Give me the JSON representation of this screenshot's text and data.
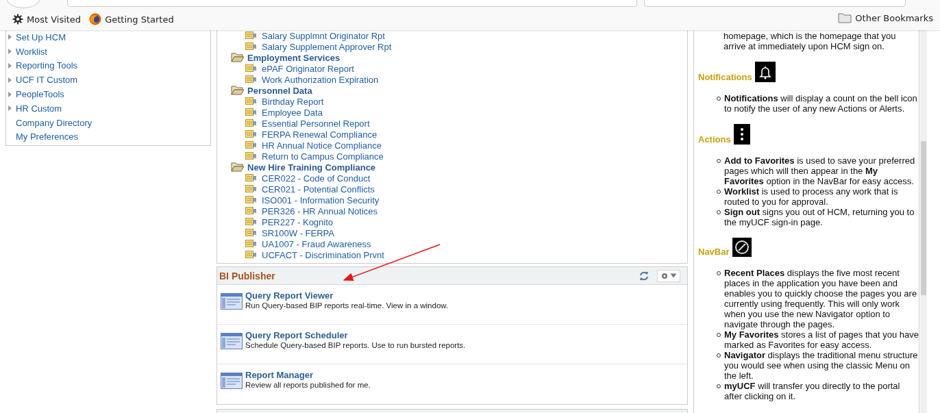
{
  "browser": {
    "bookmarks": [
      {
        "kind": "gear",
        "label": "Most Visited"
      },
      {
        "kind": "firefox",
        "label": "Getting Started"
      }
    ],
    "other_bookmarks": "Other Bookmarks"
  },
  "sidebar": {
    "items": [
      {
        "label": "Set Up HCM",
        "expandable": true
      },
      {
        "label": "Worklist",
        "expandable": true
      },
      {
        "label": "Reporting Tools",
        "expandable": true
      },
      {
        "label": "UCF IT Custom",
        "expandable": true
      },
      {
        "label": "PeopleTools",
        "expandable": true
      },
      {
        "label": "HR Custom",
        "expandable": true
      },
      {
        "label": "Company Directory",
        "expandable": false
      },
      {
        "label": "My Preferences",
        "expandable": false
      }
    ]
  },
  "report_tree": [
    {
      "kind": "report",
      "label": "Salary Supplmnt Originator Rpt"
    },
    {
      "kind": "report",
      "label": "Salary Supplement Approver Rpt"
    },
    {
      "kind": "folder",
      "label": "Employment Services",
      "children": [
        {
          "kind": "report",
          "label": "ePAF Originator Report"
        },
        {
          "kind": "report",
          "label": "Work Authorization Expiration"
        }
      ]
    },
    {
      "kind": "folder",
      "label": "Personnel Data",
      "children": [
        {
          "kind": "report",
          "label": "Birthday Report"
        },
        {
          "kind": "report",
          "label": "Employee Data"
        },
        {
          "kind": "report",
          "label": "Essential Personnel Report"
        },
        {
          "kind": "report",
          "label": "FERPA Renewal Compliance"
        },
        {
          "kind": "report",
          "label": "HR Annual Notice Compliance"
        },
        {
          "kind": "report",
          "label": "Return to Campus Compliance"
        }
      ]
    },
    {
      "kind": "folder",
      "label": "New Hire Training Compliance",
      "children": [
        {
          "kind": "report",
          "label": "CER022 - Code of Conduct"
        },
        {
          "kind": "report",
          "label": "CER021 - Potential Conflicts"
        },
        {
          "kind": "report",
          "label": "ISO001 - Information Security"
        },
        {
          "kind": "report",
          "label": "PER326 - HR Annual Notices"
        },
        {
          "kind": "report",
          "label": "PER227 - Kognito"
        },
        {
          "kind": "report",
          "label": "SR100W - FERPA"
        },
        {
          "kind": "report",
          "label": "UA1007 - Fraud Awareness"
        },
        {
          "kind": "report",
          "label": "UCFACT - Discrimination Prvnt"
        }
      ]
    }
  ],
  "bi_publisher": {
    "title": "BI Publisher",
    "items": [
      {
        "title": "Query Report Viewer",
        "description": "Run Query-based BIP reports real-time. View in a window."
      },
      {
        "title": "Query Report Scheduler",
        "description": "Schedule Query-based BIP reports. Use to run bursted reports."
      },
      {
        "title": "Report Manager",
        "description": "Review all reports published for me."
      }
    ]
  },
  "help": {
    "intro": "homepage, which is the homepage that you arrive at immediately upon HCM sign on.",
    "sections": [
      {
        "heading": "Notifications",
        "kind": "bell",
        "bullets": [
          "**Notifications** will display a count on the bell icon to notify the user of any new Actions or Alerts."
        ]
      },
      {
        "heading": "Actions",
        "kind": "dots",
        "bullets": [
          "**Add to Favorites** is used to save your preferred pages which will then appear in the **My Favorites** option in the NavBar for easy access.",
          "**Worklist** is used to process any work that is routed to you for approval.",
          "**Sign out** signs you out of HCM, returning you to the myUCF sign-in page."
        ]
      },
      {
        "heading": "NavBar",
        "kind": "compass",
        "bullets": [
          "**Recent Places** displays the five most recent places in the application you have been and enables you to quickly choose the pages you are currently using frequently. This will only work when you use the new Navigator option to navigate through the pages.",
          "**My Favorites** stores a list of pages that you have marked as Favorites for easy access.",
          "**Navigator** displays the traditional menu structure you would see when using the classic Menu on the left.",
          "**myUCF** will transfer you directly to the portal after clicking on it."
        ]
      }
    ]
  }
}
